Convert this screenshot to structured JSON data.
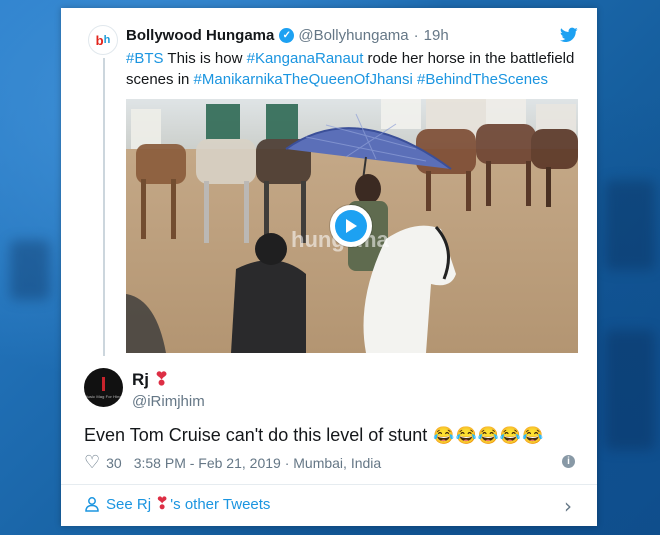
{
  "quoted_tweet": {
    "name": "Bollywood Hungama",
    "handle": "@Bollyhungama",
    "separator": "·",
    "time": "19h",
    "text_parts": [
      {
        "text": "#BTS",
        "tag": true
      },
      {
        "text": " This is how ",
        "tag": false
      },
      {
        "text": "#KanganaRanaut",
        "tag": true
      },
      {
        "text": " rode her horse in the battlefield scenes in ",
        "tag": false
      },
      {
        "text": "#ManikarnikaTheQueenOfJhansi",
        "tag": true
      },
      {
        "text": " ",
        "tag": false
      },
      {
        "text": "#BehindTheScenes",
        "tag": true
      }
    ],
    "avatar_letters": [
      "b",
      "h"
    ],
    "media_watermark": "hungama"
  },
  "reply": {
    "name": "Rj",
    "name_emoji": "❣",
    "handle": "@iRimjhim",
    "avatar_caption": "Music Mag For Hindi",
    "text": "Even Tom Cruise can't do this level of stunt",
    "emojis": [
      "😂",
      "😂",
      "😂",
      "😂",
      "😂"
    ],
    "likes": "30",
    "timestamp": "3:58 PM - Feb 21, 2019 · Mumbai, India"
  },
  "footer": {
    "prefix": "See Rj",
    "emoji": "❣",
    "suffix": "'s other Tweets"
  },
  "icons": {
    "verified": "verified-badge-icon",
    "bird": "twitter-bird-icon",
    "play": "play-icon",
    "like": "heart-outline-icon",
    "info": "info-icon",
    "person": "person-icon",
    "chevron": "chevron-right-icon"
  },
  "colors": {
    "link": "#1b95e0",
    "twitter_blue": "#1da1f2",
    "text": "#14171a",
    "secondary": "#657786",
    "background": "#1b6fb8"
  }
}
